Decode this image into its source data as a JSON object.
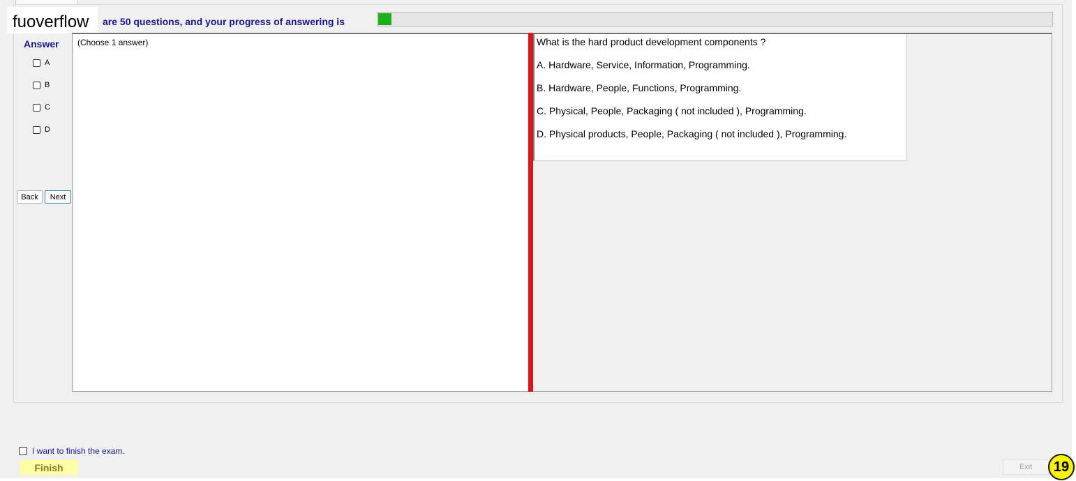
{
  "watermark": "fuoverflow",
  "header": {
    "progress_text": "are 50 questions, and your progress of answering is",
    "progress_fraction": 0.02
  },
  "answer_panel": {
    "title": "Answer",
    "options": [
      "A",
      "B",
      "C",
      "D"
    ],
    "back_label": "Back",
    "next_label": "Next"
  },
  "left_pane": {
    "hint": "(Choose 1 answer)"
  },
  "question": {
    "text": "What is the hard product development components ?",
    "choices": [
      "A.  Hardware, Service, Information, Programming.",
      "B.  Hardware, People, Functions, Programming.",
      "C.  Physical, People, Packaging ( not included ), Programming.",
      "D.  Physical products, People, Packaging ( not included ), Programming."
    ]
  },
  "footer": {
    "finish_check_label": "I want to finish the exam.",
    "finish_label": "Finish",
    "exit_label": "Exit",
    "page_number": "19"
  },
  "colors": {
    "accent_text": "#17178b",
    "progress": "#19b019",
    "splitter": "#e0141a",
    "finish_bg": "#ffffa6",
    "badge": "#f7f10e"
  }
}
